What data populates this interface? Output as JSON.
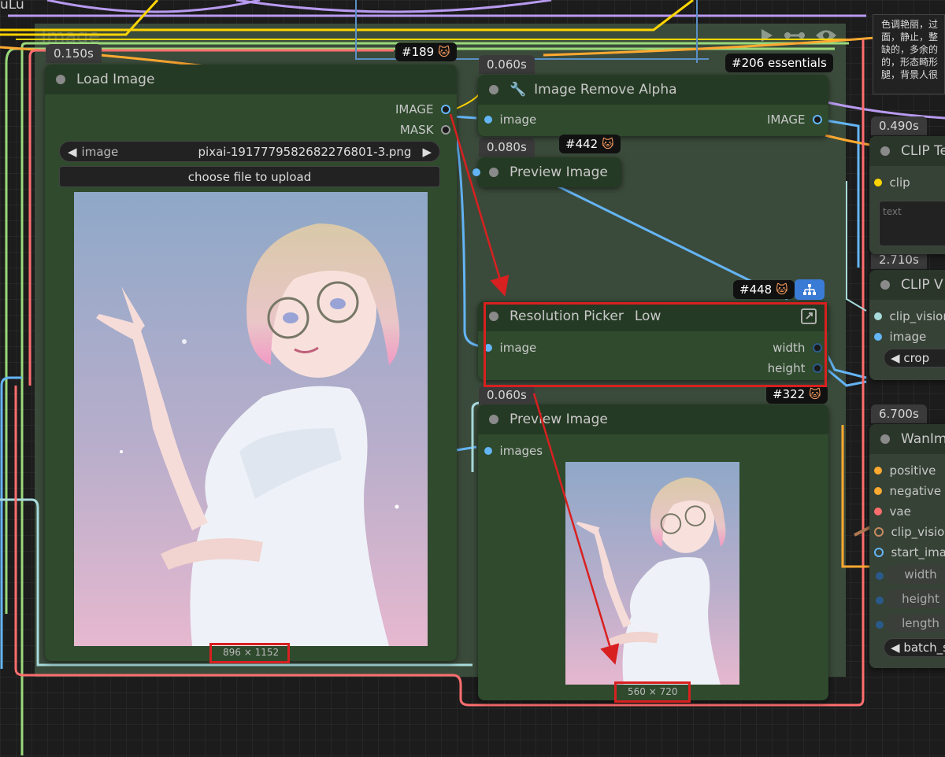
{
  "top_left_fragment": "uLu",
  "group_title": "Image",
  "group_icons": [
    "play-icon",
    "link-icon",
    "eye-icon"
  ],
  "load_image": {
    "id_tag": "#189",
    "time": "0.150s",
    "title": "Load Image",
    "outputs": [
      "IMAGE",
      "MASK"
    ],
    "image_widget_label": "image",
    "filename": "pixai-1917779582682276801-3.png",
    "upload_label": "choose file to upload",
    "dimensions": "896 × 1152"
  },
  "remove_alpha": {
    "id_tag": "#206 essentials",
    "time": "0.060s",
    "title": "Image Remove Alpha",
    "input": "image",
    "output": "IMAGE"
  },
  "preview_small": {
    "id_tag": "#442",
    "time": "0.080s",
    "title": "Preview Image"
  },
  "resolution_picker": {
    "id_tag": "#448",
    "title": "Resolution Picker",
    "mode": "Low",
    "input": "image",
    "outputs": [
      "width",
      "height"
    ]
  },
  "preview_main": {
    "id_tag": "#322",
    "time": "0.060s",
    "title": "Preview Image",
    "input": "images",
    "dimensions": "560 × 720"
  },
  "right_notes": {
    "lines": [
      "色调艳丽，过",
      "面，静止，整",
      "缺的，多余的",
      "的，形态畸形",
      "腿，背景人很"
    ]
  },
  "clip_text": {
    "time": "0.490s",
    "title": "CLIP Te",
    "input": "clip",
    "placeholder": "text"
  },
  "clip_vision": {
    "time": "2.710s",
    "title": "CLIP V",
    "inputs": [
      "clip_vision",
      "image"
    ],
    "crop_label": "crop"
  },
  "wan": {
    "time": "6.700s",
    "title": "WanIm",
    "inputs": [
      "positive",
      "negative",
      "vae",
      "clip_vision",
      "start_imag"
    ],
    "widgets": [
      "width",
      "height",
      "length"
    ],
    "batch_label": "batch_s"
  },
  "colors": {
    "image_slot": "#64b5f6",
    "clip_slot": "#ffd500",
    "cond_slot": "#ffa931",
    "vae_slot": "#ff6e6e",
    "clipvision_slot": "#a8dadc",
    "int_slot": "#2a5a8a",
    "annotation": "#d82020"
  }
}
